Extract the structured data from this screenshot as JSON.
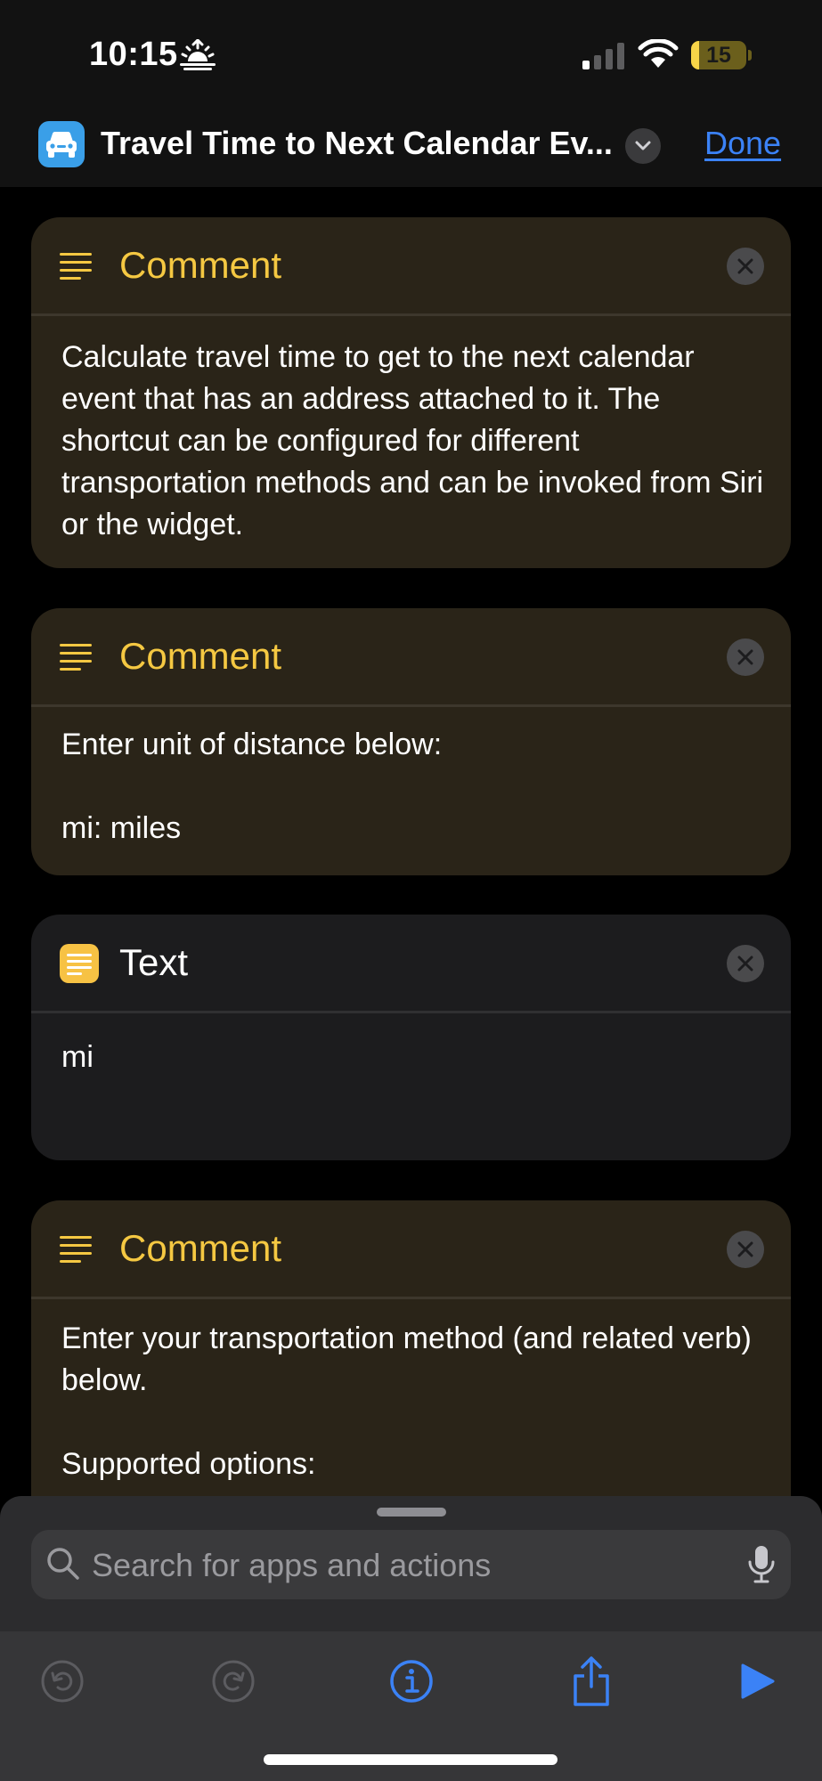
{
  "status_bar": {
    "time": "10:15",
    "battery_level": "15",
    "battery_fraction": 0.15,
    "icons": [
      "sunrise-icon",
      "cellular-signal-icon",
      "wifi-icon",
      "battery-icon"
    ]
  },
  "nav": {
    "title": "Travel Time to Next Calendar Ev...",
    "done_label": "Done",
    "app_icon": "car-icon",
    "accent_color": "#3b82f6"
  },
  "cards": [
    {
      "type": "comment",
      "title": "Comment",
      "body": "Calculate travel time to get to the next calendar event that has an address attached to it. The shortcut can be configured for different transportation methods and can be invoked from Siri or the widget."
    },
    {
      "type": "comment",
      "title": "Comment",
      "body": "Enter unit of distance below:\n\nmi: miles"
    },
    {
      "type": "text",
      "title": "Text",
      "body": "mi"
    },
    {
      "type": "comment",
      "title": "Comment",
      "body": "Enter your transportation method (and related verb) below.\n\nSupported options:"
    }
  ],
  "colors": {
    "comment_title": "#f5c842",
    "comment_card_bg": "#2a2418",
    "text_card_bg": "#1c1c1e",
    "text_icon_bg": "#f7c244"
  },
  "search": {
    "placeholder": "Search for apps and actions"
  },
  "toolbar": {
    "items": [
      "undo-icon",
      "redo-icon",
      "info-icon",
      "share-icon",
      "play-icon"
    ]
  }
}
